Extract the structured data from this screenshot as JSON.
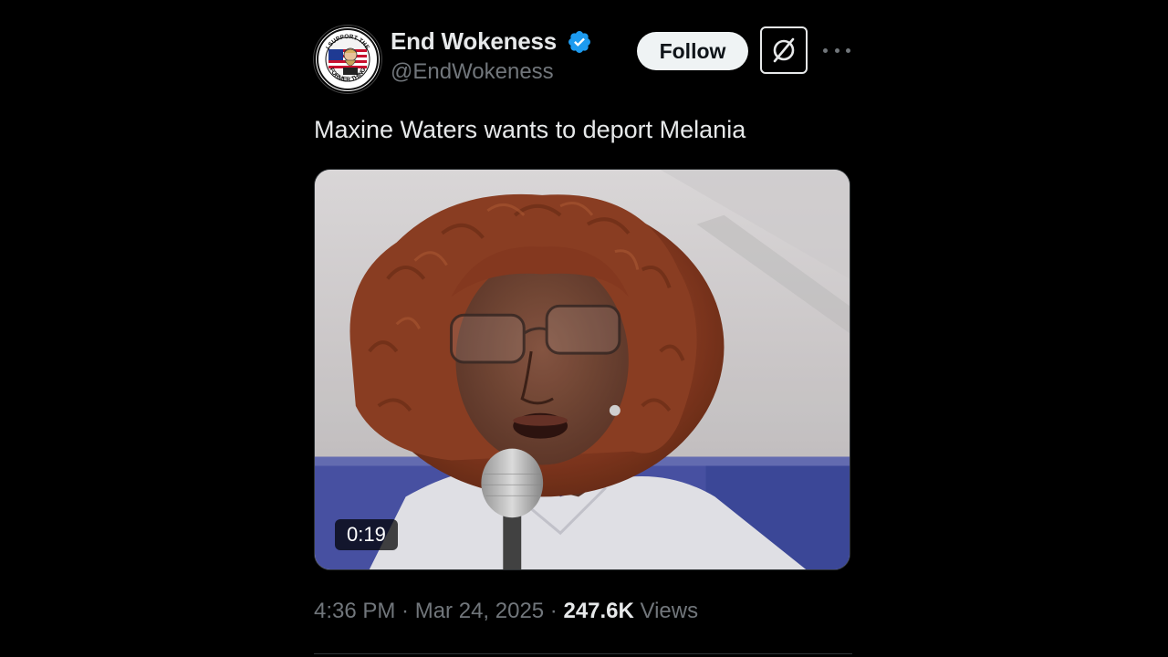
{
  "author": {
    "display_name": "End Wokeness",
    "handle": "@EndWokeness",
    "avatar_text_top": "I SUPPORT THE",
    "avatar_text_bottom": "FORMER THING"
  },
  "actions": {
    "follow_label": "Follow",
    "grok_icon": "grok-slash-circle-icon",
    "more_icon": "ellipsis-icon"
  },
  "tweet": {
    "text": "Maxine Waters wants to deport Melania"
  },
  "media": {
    "type": "video",
    "duration": "0:19"
  },
  "meta": {
    "time": "4:36 PM",
    "separator1": " · ",
    "date": "Mar 24, 2025",
    "separator2": " · ",
    "views_count": "247.6K",
    "views_label": " Views"
  },
  "colors": {
    "background": "#000000",
    "text_primary": "#e7e9ea",
    "text_secondary": "#71767b",
    "verified_blue": "#1d9bf0",
    "follow_bg": "#eff3f4"
  }
}
